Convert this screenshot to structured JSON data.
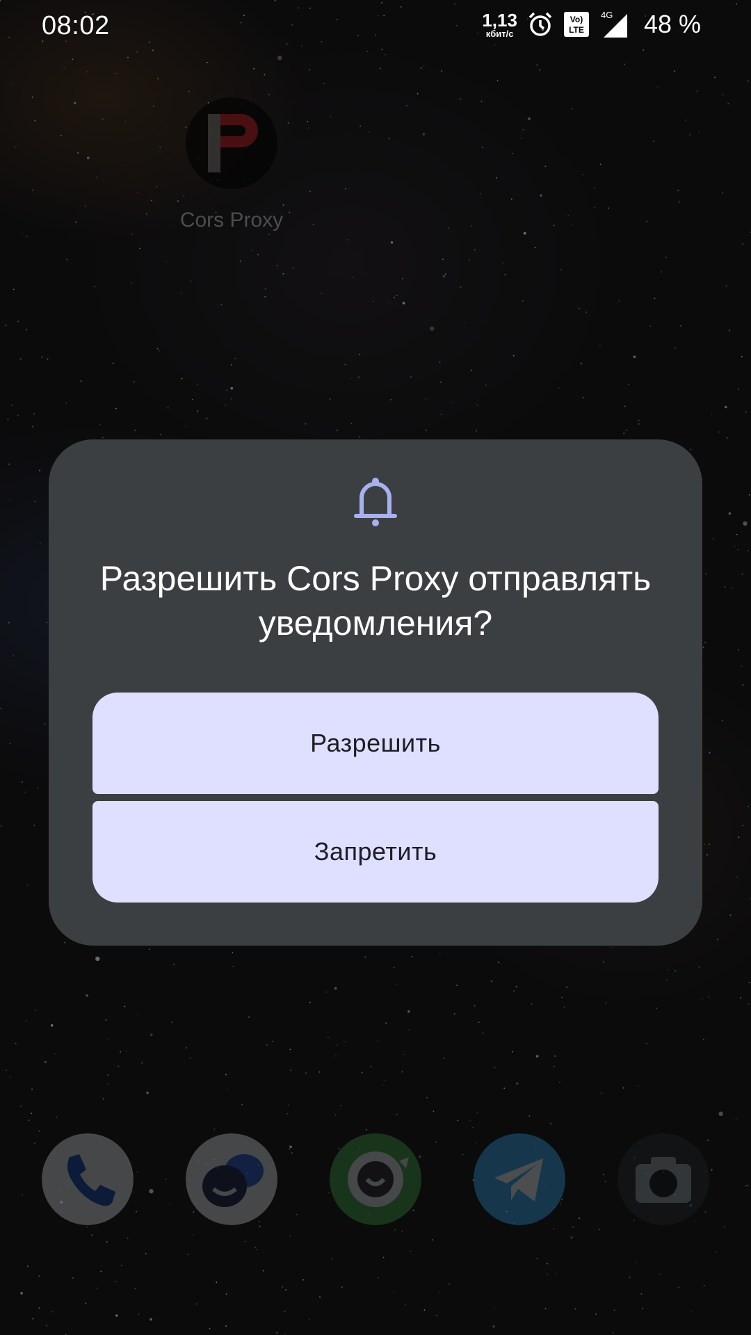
{
  "status_bar": {
    "time": "08:02",
    "net_speed_value": "1,13",
    "net_speed_unit": "кбит/с",
    "network_type": "4G",
    "volte_label_top": "Vo)",
    "volte_label_bottom": "LTE",
    "battery_percent": "48 %",
    "icons": [
      "alarm-icon",
      "volte-icon",
      "signal-icon"
    ]
  },
  "home": {
    "app_label": "Cors Proxy",
    "app_icon_letter": "P",
    "dock": [
      "phone-icon",
      "messages-icon",
      "chat-icon",
      "telegram-icon",
      "camera-icon"
    ]
  },
  "dialog": {
    "icon": "bell-icon",
    "title": "Разрешить Cors Proxy отправлять уведомления?",
    "allow_label": "Разрешить",
    "deny_label": "Запретить"
  },
  "colors": {
    "dialog_bg": "#3c3f42",
    "button_bg": "#dfe0ff",
    "bell": "#a9b0f0",
    "app_icon_accent": "#d61f26"
  }
}
